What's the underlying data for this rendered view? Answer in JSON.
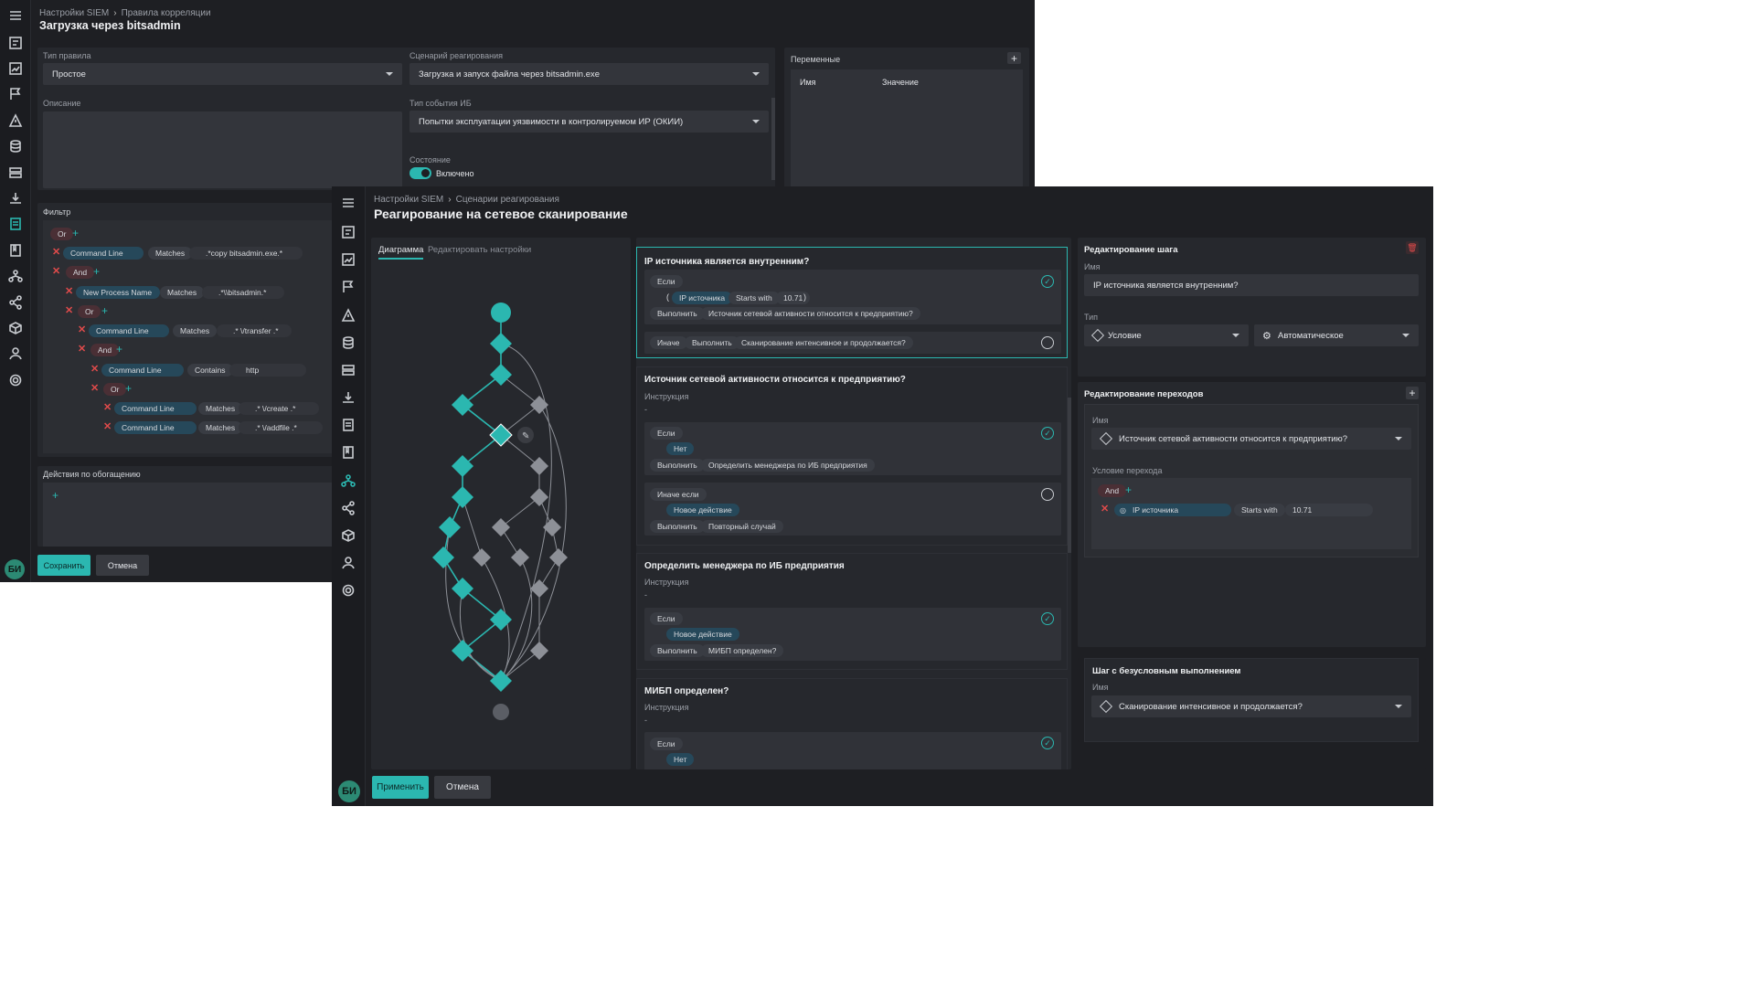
{
  "back": {
    "breadcrumb": [
      "Настройки SIEM",
      "Правила корреляции"
    ],
    "title": "Загрузка через bitsadmin",
    "rule_type_label": "Тип правила",
    "rule_type_value": "Простое",
    "scenario_label": "Сценарий реагирования",
    "scenario_value": "Загрузка и запуск файла через bitsadmin.exe",
    "description_label": "Описание",
    "event_type_label": "Тип события ИБ",
    "event_type_value": "Попытки эксплуатации уязвимости в контролируемом ИР (ОКИИ)",
    "state_label": "Состояние",
    "state_value": "Включено",
    "variables_label": "Переменные",
    "var_col_name": "Имя",
    "var_col_value": "Значение",
    "filter_label": "Фильтр",
    "filter": [
      {
        "op": "Or"
      },
      {
        "field": "Command Line",
        "cmp": "Matches",
        "val": ".*copy bitsadmin.exe.*"
      },
      {
        "op": "And"
      },
      {
        "field": "New Process Name",
        "cmp": "Matches",
        "val": ".*\\\\bitsadmin.*"
      },
      {
        "op": "Or"
      },
      {
        "field": "Command Line",
        "cmp": "Matches",
        "val": ".* \\/transfer .*"
      },
      {
        "op": "And"
      },
      {
        "field": "Command Line",
        "cmp": "Contains",
        "val": "http"
      },
      {
        "op": "Or"
      },
      {
        "field": "Command Line",
        "cmp": "Matches",
        "val": ".* \\/create .*"
      },
      {
        "field": "Command Line",
        "cmp": "Matches",
        "val": ".* \\/addfile .*"
      }
    ],
    "enrich_label": "Действия по обогащению",
    "save": "Сохранить",
    "cancel": "Отмена",
    "avatar": "БИ"
  },
  "front": {
    "breadcrumb": [
      "Настройки SIEM",
      "Сценарии реагирования"
    ],
    "title": "Реагирование на сетевое сканирование",
    "tabs": [
      "Диаграмма",
      "Редактировать настройки"
    ],
    "steps": [
      {
        "title": "IP источника является внутренним?",
        "if": "Если",
        "cond": [
          "IP источника",
          "Starts with",
          "10.71"
        ],
        "do": "Выполнить",
        "then": "Источник сетевой активности относится к предприятию?",
        "else": "Иначе",
        "else_do": "Выполнить",
        "else_then": "Сканирование интенсивное и продолжается?"
      },
      {
        "title": "Источник сетевой активности относится к предприятию?",
        "instr_label": "Инструкция",
        "instr": "-",
        "if": "Если",
        "cond": "Нет",
        "do": "Выполнить",
        "then": "Определить менеджера по ИБ предприятия",
        "elif": "Иначе если",
        "elif_cond": "Новое действие",
        "elif_do": "Выполнить",
        "elif_then": "Повторный случай"
      },
      {
        "title": "Определить менеджера по ИБ предприятия",
        "instr_label": "Инструкция",
        "instr": "-",
        "if": "Если",
        "cond": "Новое действие",
        "do": "Выполнить",
        "then": "МИБП определен?"
      },
      {
        "title": "МИБП определен?",
        "instr_label": "Инструкция",
        "instr": "-",
        "if": "Если",
        "cond": "Нет"
      }
    ],
    "edit_step": {
      "title": "Редактирование шага",
      "name_label": "Имя",
      "name": "IP источника является внутренним?",
      "type_label": "Тип",
      "type1": "Условие",
      "type2": "Автоматическое"
    },
    "transitions": {
      "title": "Редактирование переходов",
      "name_label": "Имя",
      "name": "Источник сетевой активности относится к предприятию?",
      "cond_label": "Условие перехода",
      "op": "And",
      "cond": [
        "IP источника",
        "Starts with",
        "10.71"
      ]
    },
    "unconditional": {
      "title": "Шаг с безусловным выполнением",
      "name_label": "Имя",
      "name": "Сканирование интенсивное и продолжается?"
    },
    "apply": "Применить",
    "cancel": "Отмена",
    "avatar": "БИ"
  },
  "colors": {
    "accent": "#2bb7b0",
    "danger": "#e04b4b",
    "bg": "#1e1f23"
  }
}
